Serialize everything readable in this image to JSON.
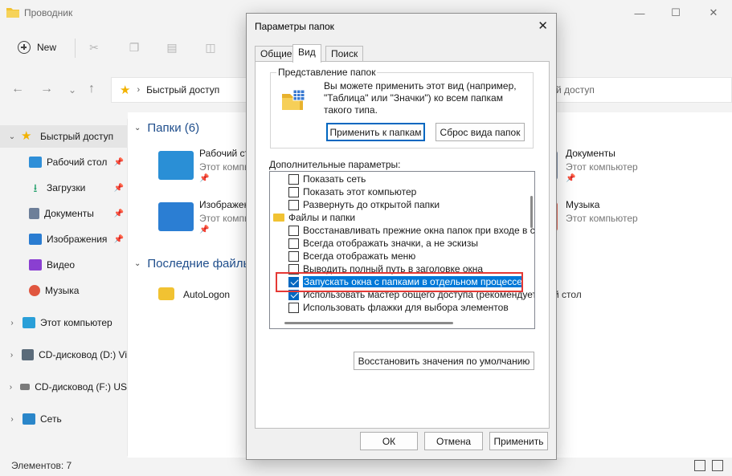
{
  "explorer": {
    "title": "Проводник",
    "controls": {
      "minimize": "—",
      "maximize": "☐",
      "close": "✕"
    },
    "toolbar": {
      "new_label": "New"
    },
    "address": {
      "segment": "Быстрый доступ",
      "right_fragment": "й доступ"
    },
    "sidebar": {
      "items": [
        {
          "label": "Быстрый доступ",
          "icon": "star-icon",
          "color": "#f2b200",
          "selected": true,
          "chevron": "⌄",
          "pinned": false
        },
        {
          "label": "Рабочий стол",
          "icon": "desktop-icon",
          "color": "#2f8fd8",
          "pinned": true
        },
        {
          "label": "Загрузки",
          "icon": "download-icon",
          "color": "#22a06b",
          "pinned": true
        },
        {
          "label": "Документы",
          "icon": "documents-icon",
          "color": "#6d7f99",
          "pinned": true
        },
        {
          "label": "Изображения",
          "icon": "pictures-icon",
          "color": "#2a7cd1",
          "pinned": true
        },
        {
          "label": "Видео",
          "icon": "video-icon",
          "color": "#8a3fd1",
          "pinned": false
        },
        {
          "label": "Музыка",
          "icon": "music-icon",
          "color": "#e0563f",
          "pinned": false
        },
        {
          "label": "Этот компьютер",
          "icon": "computer-icon",
          "color": "#2a9fd8",
          "chevron": "›"
        },
        {
          "label": "CD-дисковод (D:) Vi",
          "icon": "cd-drive-icon",
          "color": "#5b6b7a",
          "chevron": "›"
        },
        {
          "label": "CD-дисковод (F:) US",
          "icon": "cd-drive-icon",
          "color": "#7a7a7a",
          "chevron": "›"
        },
        {
          "label": "Сеть",
          "icon": "network-icon",
          "color": "#2a86c9",
          "chevron": "›"
        }
      ]
    },
    "content": {
      "folders_header": "Папки (6)",
      "recent_header": "Последние файлы",
      "tiles": [
        {
          "title": "Рабочий ст",
          "subtitle": "Этот компью",
          "icon": "desktop-folder-icon",
          "color": "#2a8fd6"
        },
        {
          "title": "Изображен",
          "subtitle": "Этот компью",
          "icon": "pictures-folder-icon",
          "color": "#2b7ed3"
        },
        {
          "title": "Документы",
          "subtitle": "Этот компьютер",
          "icon": "documents-folder-icon",
          "color": "#7a8aa5"
        },
        {
          "title": "Музыка",
          "subtitle": "Этот компьютер",
          "icon": "music-folder-icon",
          "color": "#e36a5b"
        }
      ],
      "recent_item": "AutoLogon",
      "recent_right_fragment": "й стол"
    },
    "status": {
      "count": "Элементов: 7"
    }
  },
  "dialog": {
    "title": "Параметры папок",
    "close": "✕",
    "tabs": [
      "Общие",
      "Вид",
      "Поиск"
    ],
    "active_tab": "Вид",
    "group": {
      "legend": "Представление папок",
      "text": "Вы можете применить этот вид (например, \"Таблица\" или \"Значки\") ко всем папкам такого типа.",
      "apply_button": "Применить к папкам",
      "reset_button": "Сброс вида папок"
    },
    "advanced_label": "Дополнительные параметры:",
    "options": [
      {
        "label": "Показать сеть",
        "type": "checkbox",
        "checked": false
      },
      {
        "label": "Показать этот компьютер",
        "type": "checkbox",
        "checked": false
      },
      {
        "label": "Развернуть до открытой папки",
        "type": "checkbox",
        "checked": false
      },
      {
        "label": "Файлы и папки",
        "type": "folder-header"
      },
      {
        "label": "Восстанавливать прежние окна папок при входе в си",
        "type": "checkbox",
        "checked": false
      },
      {
        "label": "Всегда отображать значки, а не эскизы",
        "type": "checkbox",
        "checked": false
      },
      {
        "label": "Всегда отображать меню",
        "type": "checkbox",
        "checked": false
      },
      {
        "label": "Выводить полный путь в заголовке окна",
        "type": "checkbox",
        "checked": false
      },
      {
        "label": "Запускать окна с папками в отдельном процессе",
        "type": "checkbox",
        "checked": true,
        "selected": true
      },
      {
        "label": "Использовать мастер общего доступа (рекомендует",
        "type": "checkbox",
        "checked": true
      },
      {
        "label": "Использовать флажки для выбора элементов",
        "type": "checkbox",
        "checked": false
      }
    ],
    "restore_button": "Восстановить значения по умолчанию",
    "ok_button": "ОК",
    "cancel_button": "Отмена",
    "apply_button": "Применить",
    "highlight_color": "#e53935",
    "accent_color": "#0067c0"
  }
}
